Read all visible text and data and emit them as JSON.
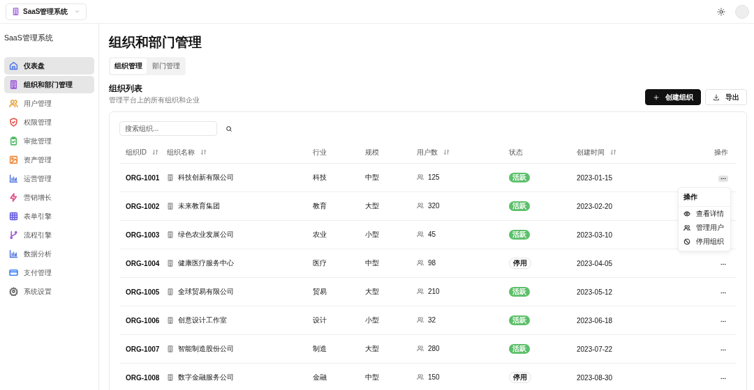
{
  "app_switcher": {
    "label": "SaaS管理系统"
  },
  "sidebar": {
    "title": "SaaS管理系统",
    "items": [
      {
        "label": "仪表盘",
        "color": "#5b7ee5",
        "selected": true
      },
      {
        "label": "组织和部门管理",
        "color": "#9b59d9",
        "selected": true
      },
      {
        "label": "用户管理",
        "color": "#e8a23a",
        "selected": false
      },
      {
        "label": "权限管理",
        "color": "#e5534b",
        "selected": false
      },
      {
        "label": "审批管理",
        "color": "#4cb860",
        "selected": false
      },
      {
        "label": "资产管理",
        "color": "#ee8a3c",
        "selected": false
      },
      {
        "label": "运营管理",
        "color": "#5b7ee5",
        "selected": false
      },
      {
        "label": "营销增长",
        "color": "#e0508a",
        "selected": false
      },
      {
        "label": "表单引擎",
        "color": "#6c63e0",
        "selected": false
      },
      {
        "label": "流程引擎",
        "color": "#a05ad9",
        "selected": false
      },
      {
        "label": "数据分析",
        "color": "#5b7ee5",
        "selected": false
      },
      {
        "label": "支付管理",
        "color": "#3b82f6",
        "selected": false
      },
      {
        "label": "系统设置",
        "color": "#666666",
        "selected": false
      }
    ]
  },
  "page_title": "组织和部门管理",
  "tabs": [
    {
      "label": "组织管理",
      "selected": true
    },
    {
      "label": "部门管理",
      "selected": false
    }
  ],
  "section": {
    "title": "组织列表",
    "subtitle": "管理平台上的所有组织和企业"
  },
  "buttons": [
    {
      "label": "创建组织",
      "kind": "primary"
    },
    {
      "label": "导出",
      "kind": "secondary"
    }
  ],
  "search": {
    "placeholder": "搜索组织..."
  },
  "table": {
    "columns": [
      {
        "label": "组织ID",
        "sortable": true
      },
      {
        "label": "组织名称",
        "sortable": true
      },
      {
        "label": "行业",
        "sortable": false
      },
      {
        "label": "规模",
        "sortable": false
      },
      {
        "label": "用户数",
        "sortable": true
      },
      {
        "label": "状态",
        "sortable": false
      },
      {
        "label": "创建时间",
        "sortable": true
      },
      {
        "label": "操作",
        "sortable": false
      }
    ],
    "rows": [
      {
        "id": "ORG-1001",
        "name": "科技创新有限公司",
        "industry": "科技",
        "size": "中型",
        "users": "125",
        "status": "活跃",
        "active": true,
        "created": "2023-01-15",
        "action_visible": true,
        "menu_open": true
      },
      {
        "id": "ORG-1002",
        "name": "未来教育集团",
        "industry": "教育",
        "size": "大型",
        "users": "320",
        "status": "活跃",
        "active": true,
        "created": "2023-02-20",
        "action_visible": false,
        "menu_open": false
      },
      {
        "id": "ORG-1003",
        "name": "绿色农业发展公司",
        "industry": "农业",
        "size": "小型",
        "users": "45",
        "status": "活跃",
        "active": true,
        "created": "2023-03-10",
        "action_visible": false,
        "menu_open": false
      },
      {
        "id": "ORG-1004",
        "name": "健康医疗服务中心",
        "industry": "医疗",
        "size": "中型",
        "users": "98",
        "status": "停用",
        "active": false,
        "created": "2023-04-05",
        "action_visible": true,
        "menu_open": false
      },
      {
        "id": "ORG-1005",
        "name": "全球贸易有限公司",
        "industry": "贸易",
        "size": "大型",
        "users": "210",
        "status": "活跃",
        "active": true,
        "created": "2023-05-12",
        "action_visible": true,
        "menu_open": false
      },
      {
        "id": "ORG-1006",
        "name": "创意设计工作室",
        "industry": "设计",
        "size": "小型",
        "users": "32",
        "status": "活跃",
        "active": true,
        "created": "2023-06-18",
        "action_visible": true,
        "menu_open": false
      },
      {
        "id": "ORG-1007",
        "name": "智能制造股份公司",
        "industry": "制造",
        "size": "大型",
        "users": "280",
        "status": "活跃",
        "active": true,
        "created": "2023-07-22",
        "action_visible": true,
        "menu_open": false
      },
      {
        "id": "ORG-1008",
        "name": "数字金融服务公司",
        "industry": "金融",
        "size": "中型",
        "users": "150",
        "status": "停用",
        "active": false,
        "created": "2023-08-30",
        "action_visible": true,
        "menu_open": false
      }
    ]
  },
  "action_menu": {
    "title": "操作",
    "items": [
      {
        "label": "查看详情"
      },
      {
        "label": "管理用户"
      },
      {
        "label": "停用组织"
      }
    ]
  }
}
